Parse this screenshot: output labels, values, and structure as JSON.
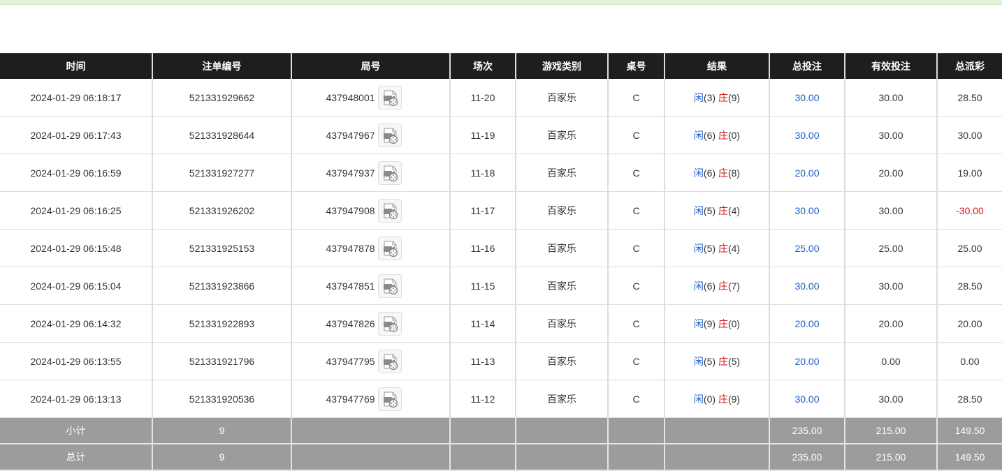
{
  "headers": [
    "时间",
    "注单编号",
    "局号",
    "场次",
    "游戏类别",
    "桌号",
    "结果",
    "总投注",
    "有效投注",
    "总派彩"
  ],
  "rows": [
    {
      "time": "2024-01-29 06:18:17",
      "bet_id": "521331929662",
      "round": "437948001",
      "shoe": "11-20",
      "game": "百家乐",
      "table": "C",
      "player_label": "闲",
      "player_score": "(3)",
      "banker_label": "庄",
      "banker_score": "(9)",
      "total_bet": "30.00",
      "valid_bet": "30.00",
      "payout": "28.50",
      "payout_negative": false
    },
    {
      "time": "2024-01-29 06:17:43",
      "bet_id": "521331928644",
      "round": "437947967",
      "shoe": "11-19",
      "game": "百家乐",
      "table": "C",
      "player_label": "闲",
      "player_score": "(6)",
      "banker_label": "庄",
      "banker_score": "(0)",
      "total_bet": "30.00",
      "valid_bet": "30.00",
      "payout": "30.00",
      "payout_negative": false
    },
    {
      "time": "2024-01-29 06:16:59",
      "bet_id": "521331927277",
      "round": "437947937",
      "shoe": "11-18",
      "game": "百家乐",
      "table": "C",
      "player_label": "闲",
      "player_score": "(6)",
      "banker_label": "庄",
      "banker_score": "(8)",
      "total_bet": "20.00",
      "valid_bet": "20.00",
      "payout": "19.00",
      "payout_negative": false
    },
    {
      "time": "2024-01-29 06:16:25",
      "bet_id": "521331926202",
      "round": "437947908",
      "shoe": "11-17",
      "game": "百家乐",
      "table": "C",
      "player_label": "闲",
      "player_score": "(5)",
      "banker_label": "庄",
      "banker_score": "(4)",
      "total_bet": "30.00",
      "valid_bet": "30.00",
      "payout": "-30.00",
      "payout_negative": true
    },
    {
      "time": "2024-01-29 06:15:48",
      "bet_id": "521331925153",
      "round": "437947878",
      "shoe": "11-16",
      "game": "百家乐",
      "table": "C",
      "player_label": "闲",
      "player_score": "(5)",
      "banker_label": "庄",
      "banker_score": "(4)",
      "total_bet": "25.00",
      "valid_bet": "25.00",
      "payout": "25.00",
      "payout_negative": false
    },
    {
      "time": "2024-01-29 06:15:04",
      "bet_id": "521331923866",
      "round": "437947851",
      "shoe": "11-15",
      "game": "百家乐",
      "table": "C",
      "player_label": "闲",
      "player_score": "(6)",
      "banker_label": "庄",
      "banker_score": "(7)",
      "total_bet": "30.00",
      "valid_bet": "30.00",
      "payout": "28.50",
      "payout_negative": false
    },
    {
      "time": "2024-01-29 06:14:32",
      "bet_id": "521331922893",
      "round": "437947826",
      "shoe": "11-14",
      "game": "百家乐",
      "table": "C",
      "player_label": "闲",
      "player_score": "(9)",
      "banker_label": "庄",
      "banker_score": "(0)",
      "total_bet": "20.00",
      "valid_bet": "20.00",
      "payout": "20.00",
      "payout_negative": false
    },
    {
      "time": "2024-01-29 06:13:55",
      "bet_id": "521331921796",
      "round": "437947795",
      "shoe": "11-13",
      "game": "百家乐",
      "table": "C",
      "player_label": "闲",
      "player_score": "(5)",
      "banker_label": "庄",
      "banker_score": "(5)",
      "total_bet": "20.00",
      "valid_bet": "0.00",
      "payout": "0.00",
      "payout_negative": false
    },
    {
      "time": "2024-01-29 06:13:13",
      "bet_id": "521331920536",
      "round": "437947769",
      "shoe": "11-12",
      "game": "百家乐",
      "table": "C",
      "player_label": "闲",
      "player_score": "(0)",
      "banker_label": "庄",
      "banker_score": "(9)",
      "total_bet": "30.00",
      "valid_bet": "30.00",
      "payout": "28.50",
      "payout_negative": false
    }
  ],
  "subtotal": {
    "label": "小计",
    "count": "9",
    "total_bet": "235.00",
    "valid_bet": "215.00",
    "payout": "149.50"
  },
  "grand_total": {
    "label": "总计",
    "count": "9",
    "total_bet": "235.00",
    "valid_bet": "215.00",
    "payout": "149.50"
  },
  "icons": {
    "round_replay": "video-replay-icon"
  },
  "colors": {
    "player": "#1d5cc7",
    "banker": "#d6171f",
    "header_bg": "#1e1e1e",
    "summary_bg": "#9c9c9c",
    "negative": "#d6171f"
  }
}
